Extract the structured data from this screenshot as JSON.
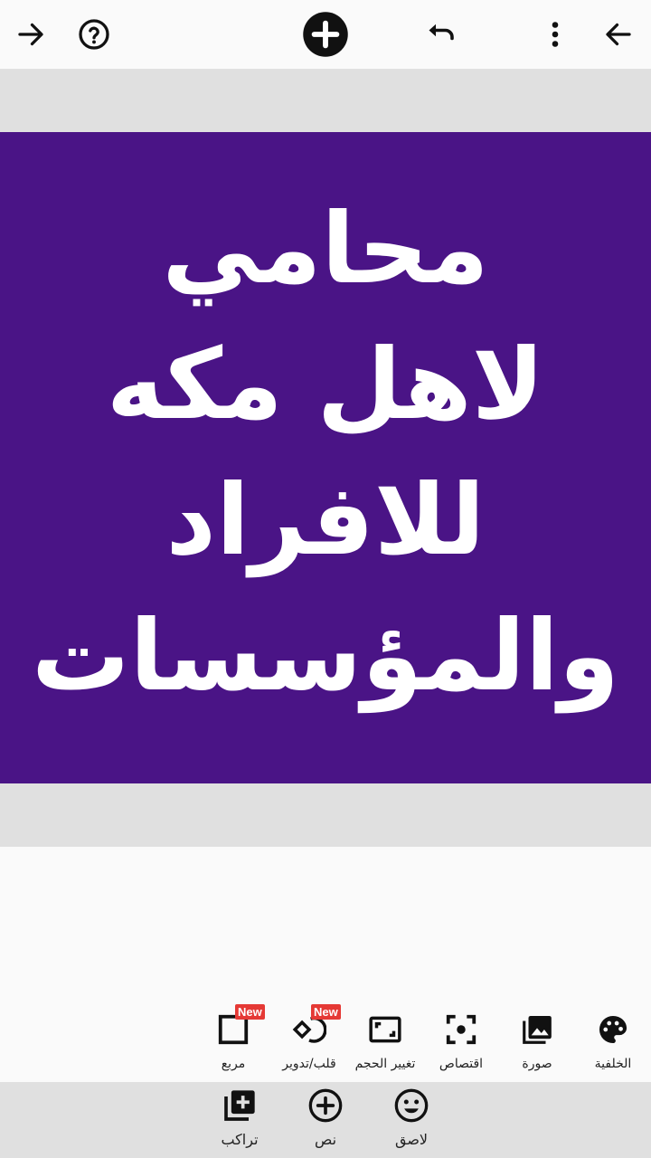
{
  "toolbar": {
    "forward_icon": "arrow-right-icon",
    "help_icon": "help-circle-icon",
    "add_icon": "plus-circle-icon",
    "undo_icon": "undo-icon",
    "menu_icon": "more-vertical-icon",
    "back_icon": "arrow-left-icon"
  },
  "canvas": {
    "background_color": "#4a1486",
    "text_color": "#ffffff",
    "text": "محامي\nلاهل مكه\nللافراد\nوالمؤسسات"
  },
  "tools": [
    {
      "label": "الخلفية",
      "icon": "palette-icon"
    },
    {
      "label": "صورة",
      "icon": "image-icon"
    },
    {
      "label": "اقتصاص",
      "icon": "crop-focus-icon"
    },
    {
      "label": "تغيير الحجم",
      "icon": "resize-icon"
    },
    {
      "label": "قلب/تدوير",
      "icon": "flip-rotate-icon",
      "badge": "New"
    },
    {
      "label": "مربع",
      "icon": "square-icon",
      "badge": "New"
    }
  ],
  "bottom_bar": [
    {
      "label": "لاصق",
      "icon": "sticker-smile-icon"
    },
    {
      "label": "نص",
      "icon": "add-text-circle-icon"
    },
    {
      "label": "تراكب",
      "icon": "overlay-add-icon"
    }
  ],
  "colors": {
    "badge": "#e53935",
    "gray_band": "#e0e0e0",
    "toolbar_bg": "#fafafa"
  }
}
